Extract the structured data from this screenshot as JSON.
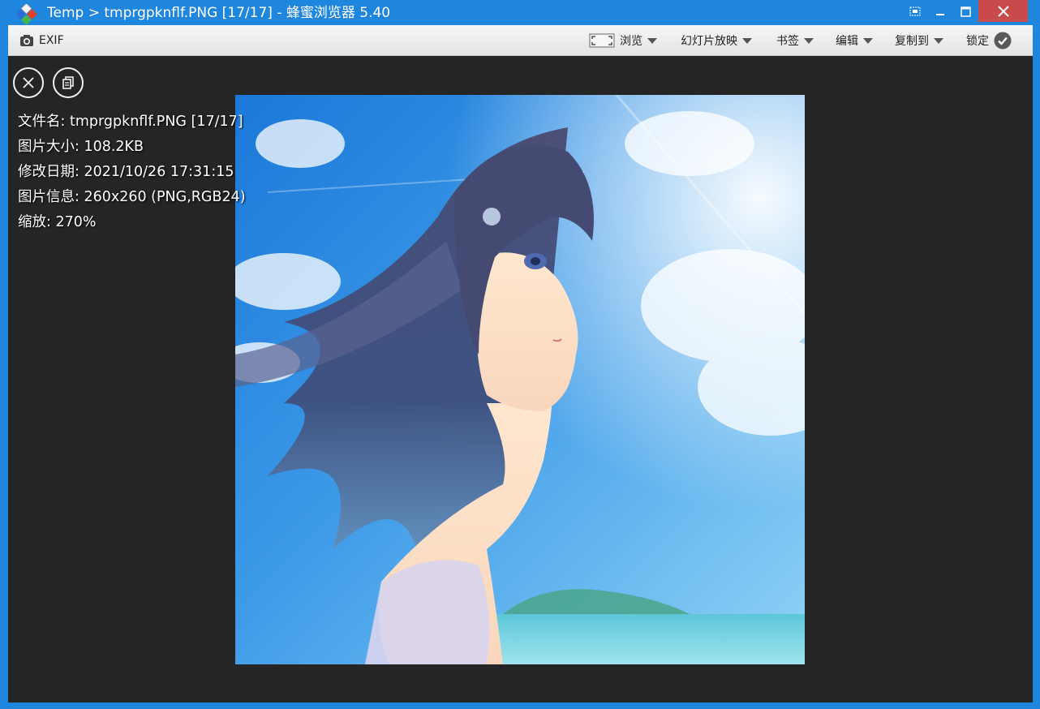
{
  "window": {
    "title": "Temp > tmprgpknflf.PNG [17/17] - 蜂蜜浏览器 5.40",
    "accent": "#1e86dc",
    "close_color": "#c84a4a"
  },
  "toolbar": {
    "exif_label": "EXIF",
    "browse_label": "浏览",
    "slideshow_label": "幻灯片放映",
    "bookmark_label": "书签",
    "edit_label": "编辑",
    "copyto_label": "复制到",
    "lock_label": "锁定"
  },
  "info": {
    "filename": "文件名: tmprgpknflf.PNG [17/17]",
    "filesize": "图片大小: 108.2KB",
    "modified": "修改日期: 2021/10/26 17:31:15",
    "imageinfo": "图片信息: 260x260 (PNG,RGB24)",
    "zoom": "缩放: 270%"
  },
  "icons": {
    "close_round": "close-icon",
    "copy_round": "copy-icon",
    "camera": "camera-icon",
    "fullscreen": "fullscreen-icon",
    "lock_check": "check-circle-icon"
  }
}
